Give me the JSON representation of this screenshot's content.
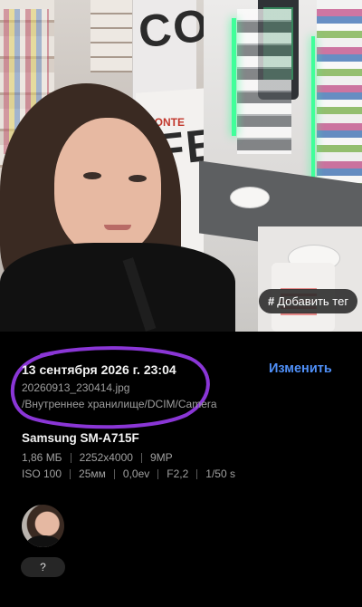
{
  "photo": {
    "add_tag_label": "Добавить тег",
    "add_tag_icon": "#",
    "banner_text": "CO\nFE",
    "brand_text": "CONTE"
  },
  "details": {
    "date_time": "13 сентября 2026 г. 23:04",
    "edit_label": "Изменить",
    "file_name": "20260913_230414.jpg",
    "file_path": "/Внутреннее хранилище/DCIM/Camera",
    "device": "Samsung SM-A715F",
    "file_size": "1,86 МБ",
    "resolution": "2252x4000",
    "megapixels": "9MP",
    "iso": "ISO 100",
    "focal_length": "25мм",
    "exposure_value": "0,0ev",
    "aperture": "F2,2",
    "shutter_speed": "1/50 s",
    "annotation_color": "#8a36d6",
    "accent_color": "#4f8ff7"
  },
  "people": {
    "tagged_faces": [
      {
        "name": "?"
      }
    ]
  }
}
